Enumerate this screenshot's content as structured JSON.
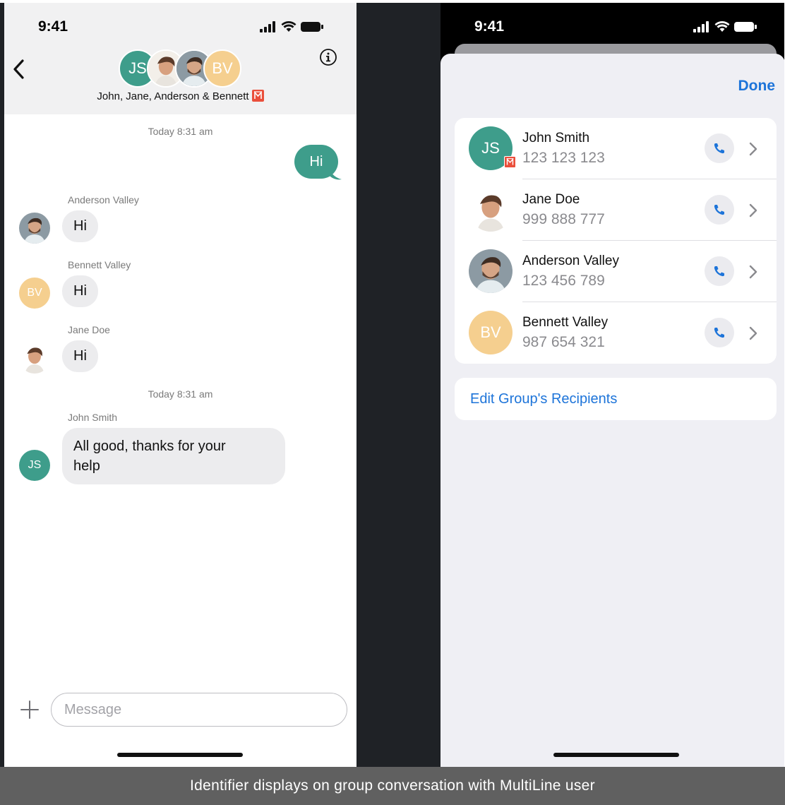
{
  "left": {
    "status_time": "9:41",
    "group_initials_js": "JS",
    "group_initials_bv": "BV",
    "group_name": "John, Jane, Anderson & Bennett",
    "timestamp_1": "Today 8:31 am",
    "outgoing_text": "Hi",
    "messages": [
      {
        "sender": "Anderson Valley",
        "text": "Hi"
      },
      {
        "sender": "Bennett Valley",
        "text": "Hi",
        "initials": "BV"
      },
      {
        "sender": "Jane Doe",
        "text": "Hi"
      }
    ],
    "timestamp_2": "Today 8:31 am",
    "last_message": {
      "sender": "John Smith",
      "text_line1": "All good, thanks for your",
      "text_line2": "help",
      "initials": "JS"
    },
    "message_placeholder": "Message"
  },
  "right": {
    "status_time": "9:41",
    "done_label": "Done",
    "contacts": [
      {
        "initials": "JS",
        "name": "John Smith",
        "number": "123 123 123"
      },
      {
        "name": "Jane Doe",
        "number": "999 888 777"
      },
      {
        "name": "Anderson Valley",
        "number": "123 456 789"
      },
      {
        "initials": "BV",
        "name": "Bennett Valley",
        "number": "987 654 321"
      }
    ],
    "edit_recipients_label": "Edit Group's Recipients"
  },
  "caption": "Identifier displays on group conversation with MultiLine user",
  "colors": {
    "accent_teal": "#3e9d8b",
    "link_blue": "#1d74d9",
    "badge_red": "#ea4f3b",
    "bv_peach": "#f5cf8f"
  }
}
